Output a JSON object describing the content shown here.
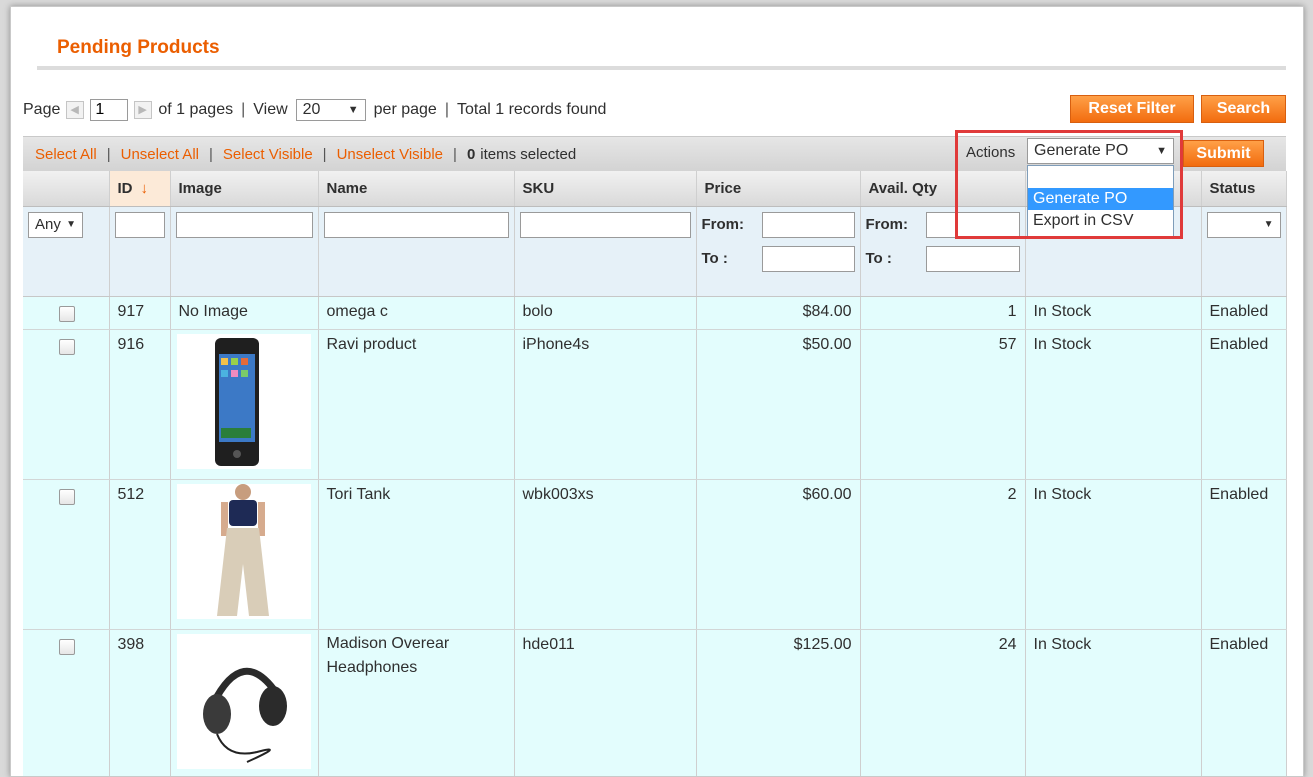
{
  "page_title": "Pending Products",
  "pager": {
    "page_label": "Page",
    "page_value": "1",
    "of_pages": "of 1 pages",
    "sep1": "|",
    "view_label": "View",
    "view_value": "20",
    "per_page": "per page",
    "sep2": "|",
    "total": "Total 1 records found"
  },
  "buttons": {
    "reset_filter": "Reset Filter",
    "search": "Search",
    "submit": "Submit"
  },
  "massaction": {
    "select_all": "Select All",
    "unselect_all": "Unselect All",
    "select_visible": "Select Visible",
    "unselect_visible": "Unselect Visible",
    "sep": "|",
    "count": "0",
    "items_selected": "items selected",
    "actions_label": "Actions",
    "actions_value": "Generate PO",
    "options": [
      "",
      "Generate PO",
      "Export in CSV"
    ]
  },
  "columns": {
    "id": "ID",
    "image": "Image",
    "name": "Name",
    "sku": "SKU",
    "price": "Price",
    "qty": "Avail. Qty",
    "status": "Status"
  },
  "filters": {
    "any": "Any",
    "from": "From:",
    "to": "To :"
  },
  "rows": [
    {
      "id": "917",
      "image": "No Image",
      "name": "omega c",
      "sku": "bolo",
      "price": "$84.00",
      "qty": "1",
      "stock": "In Stock",
      "status": "Enabled"
    },
    {
      "id": "916",
      "image": "",
      "name": "Ravi product",
      "sku": "iPhone4s",
      "price": "$50.00",
      "qty": "57",
      "stock": "In Stock",
      "status": "Enabled"
    },
    {
      "id": "512",
      "image": "",
      "name": "Tori Tank",
      "sku": "wbk003xs",
      "price": "$60.00",
      "qty": "2",
      "stock": "In Stock",
      "status": "Enabled"
    },
    {
      "id": "398",
      "image": "",
      "name": "Madison Overear Headphones",
      "sku": "hde011",
      "price": "$125.00",
      "qty": "24",
      "stock": "In Stock",
      "status": "Enabled"
    }
  ],
  "icons": {
    "sort": "sort-down-arrow-icon",
    "dropdown": "chevron-down-icon"
  },
  "colors": {
    "accent": "#eb5e00",
    "row_bg": "#e3fdfd",
    "highlight": "#e03a3a"
  }
}
